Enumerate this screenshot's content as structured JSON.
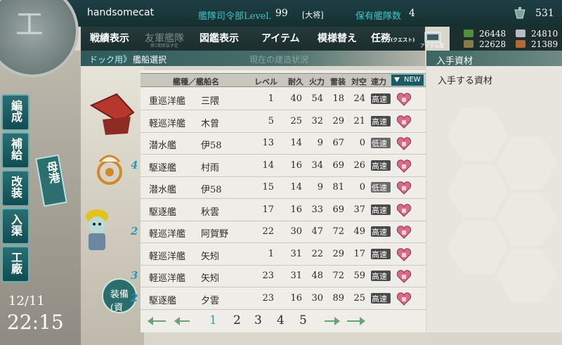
{
  "header": {
    "admiral_name": "handsomecat",
    "level_label": "艦隊司令部Level.",
    "level_value": "99",
    "rank": "[大将]",
    "ships_label": "保有艦隊数",
    "ships_value": "4",
    "buckets": "531"
  },
  "menu": {
    "items": [
      "戦績表示",
      "友軍艦隊",
      "図鑑表示",
      "アイテム",
      "模様替え",
      "任務"
    ],
    "quest_small": "(クエスト)",
    "sub_note": "第2期実装予定",
    "item_shop_label": "アイテム屋"
  },
  "resources": {
    "fuel": "26448",
    "ammo": "22628",
    "steel": "24810",
    "bauxite": "21389"
  },
  "subbar": {
    "dock_label": "ドック用",
    "separator": "》",
    "select_label": "艦船選択",
    "current_label": "現在の建造状況"
  },
  "right_panel": {
    "header": "入手資材",
    "label": "入手する資材"
  },
  "side_buttons": [
    "編成",
    "補給",
    "改装",
    "入渠",
    "工廠"
  ],
  "port_button": "母港",
  "build_button": "装備\n(資",
  "clock": {
    "date": "12/11",
    "time": "22:15"
  },
  "table": {
    "columns": [
      "艦種／艦船名",
      "レベル",
      "耐久",
      "火力",
      "雷装",
      "対空",
      "速力"
    ],
    "new_label": "NEW",
    "rows": [
      {
        "fleet": "",
        "type": "重巡洋艦",
        "name": "三隈",
        "level": "1",
        "hp": "40",
        "fp": "54",
        "torp": "18",
        "aa": "24",
        "speed": "高速"
      },
      {
        "fleet": "",
        "type": "軽巡洋艦",
        "name": "木曾",
        "level": "5",
        "hp": "25",
        "fp": "32",
        "torp": "29",
        "aa": "21",
        "speed": "高速"
      },
      {
        "fleet": "",
        "type": "潜水艦",
        "name": "伊58",
        "level": "13",
        "hp": "14",
        "fp": "9",
        "torp": "67",
        "aa": "0",
        "speed": "低速"
      },
      {
        "fleet": "4",
        "type": "駆逐艦",
        "name": "村雨",
        "level": "14",
        "hp": "16",
        "fp": "34",
        "torp": "69",
        "aa": "26",
        "speed": "高速"
      },
      {
        "fleet": "",
        "type": "潜水艦",
        "name": "伊58",
        "level": "15",
        "hp": "14",
        "fp": "9",
        "torp": "81",
        "aa": "0",
        "speed": "低速"
      },
      {
        "fleet": "",
        "type": "駆逐艦",
        "name": "秋雲",
        "level": "17",
        "hp": "16",
        "fp": "33",
        "torp": "69",
        "aa": "37",
        "speed": "高速"
      },
      {
        "fleet": "2",
        "type": "軽巡洋艦",
        "name": "阿賀野",
        "level": "22",
        "hp": "30",
        "fp": "47",
        "torp": "72",
        "aa": "49",
        "speed": "高速"
      },
      {
        "fleet": "",
        "type": "軽巡洋艦",
        "name": "矢矧",
        "level": "1",
        "hp": "31",
        "fp": "22",
        "torp": "29",
        "aa": "17",
        "speed": "高速"
      },
      {
        "fleet": "3",
        "type": "軽巡洋艦",
        "name": "矢矧",
        "level": "23",
        "hp": "31",
        "fp": "48",
        "torp": "72",
        "aa": "59",
        "speed": "高速"
      },
      {
        "fleet": "2",
        "type": "駆逐艦",
        "name": "夕雲",
        "level": "23",
        "hp": "16",
        "fp": "30",
        "torp": "89",
        "aa": "25",
        "speed": "高速"
      }
    ]
  },
  "pager": {
    "pages": [
      "1",
      "2",
      "3",
      "4",
      "5"
    ],
    "active": "1"
  },
  "colors": {
    "accent": "#2aa4c0",
    "topbar": "#1f3f46",
    "new_button": "#1a5c64"
  }
}
